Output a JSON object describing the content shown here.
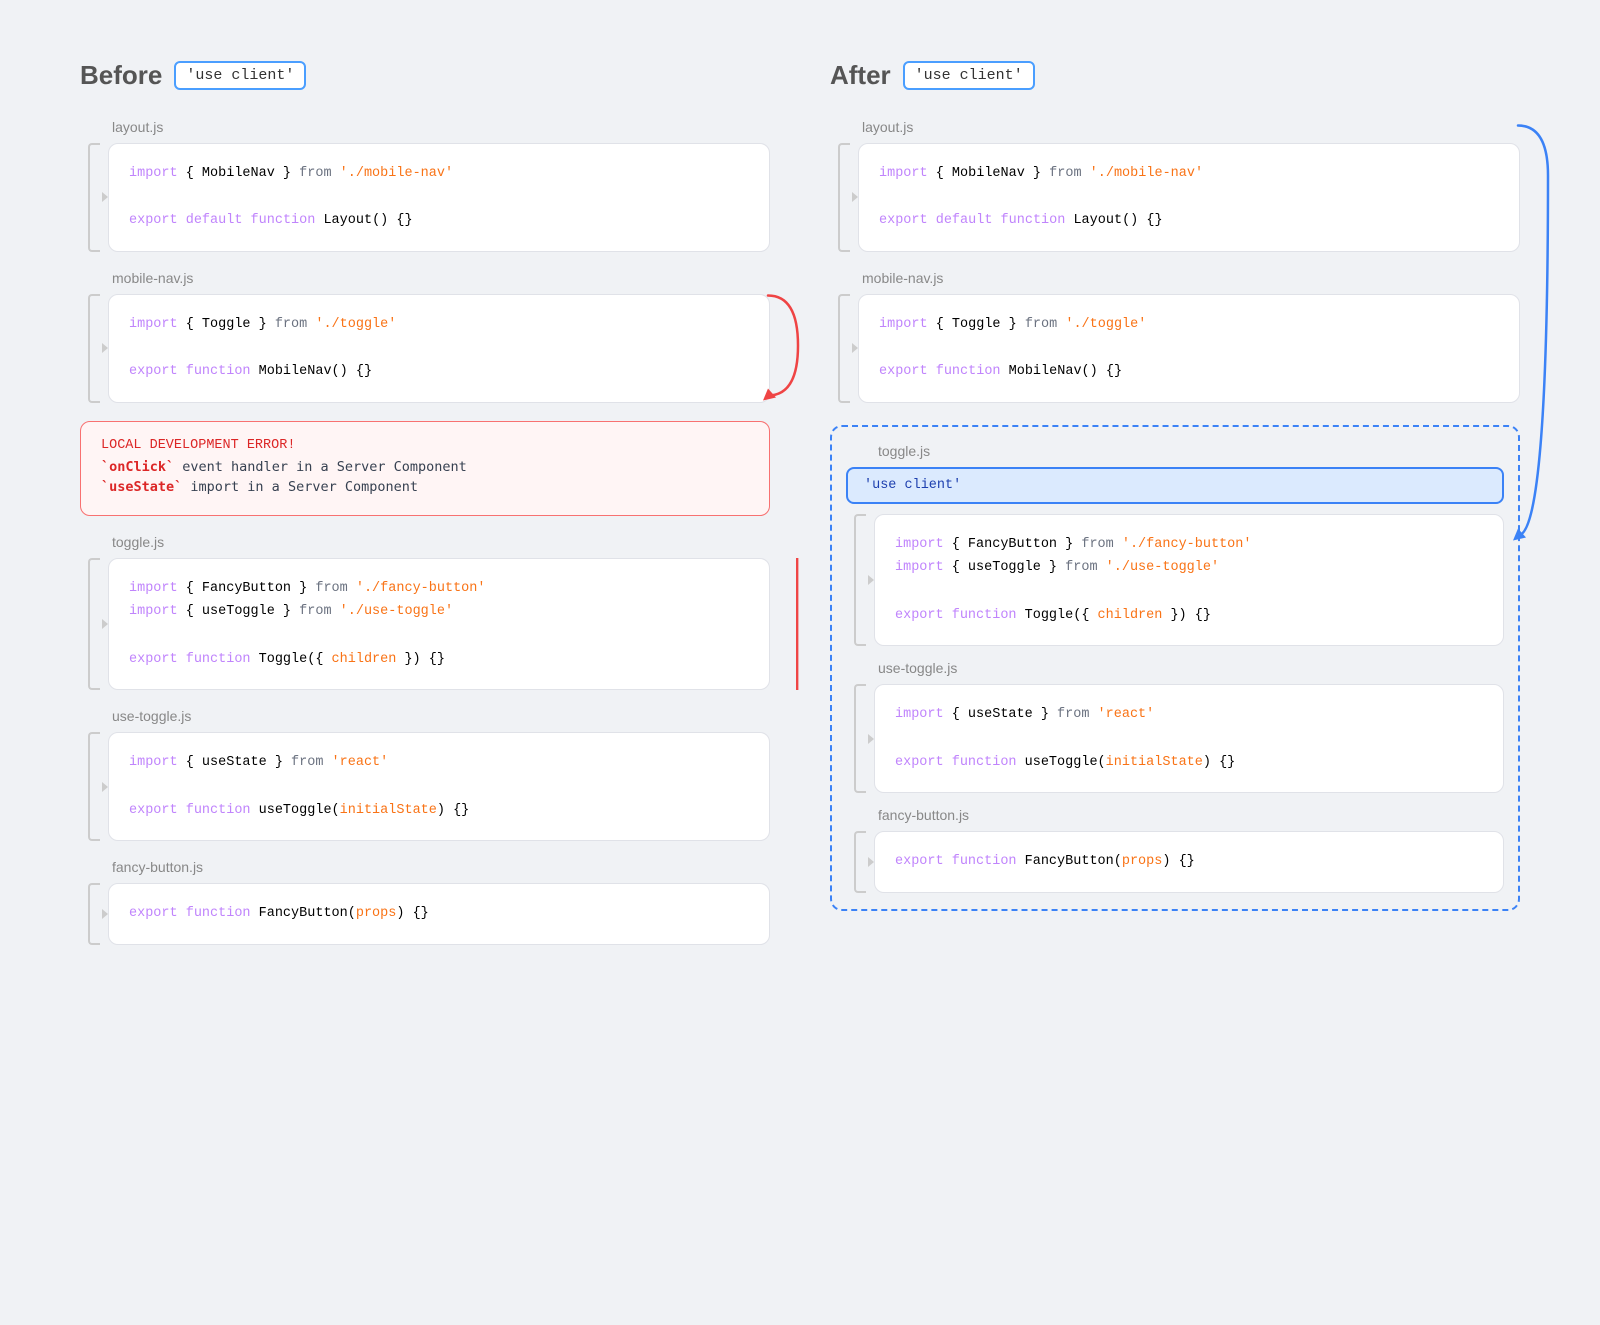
{
  "before": {
    "title": "Before",
    "badge": "'use client'",
    "files": [
      {
        "name": "layout.js",
        "lines": [
          {
            "parts": [
              {
                "text": "import",
                "class": "kw"
              },
              {
                "text": " { MobileNav } ",
                "class": ""
              },
              {
                "text": "from",
                "class": "gray"
              },
              {
                "text": " ",
                "class": ""
              },
              {
                "text": "'./mobile-nav'",
                "class": "str"
              }
            ]
          },
          {
            "parts": []
          },
          {
            "parts": [
              {
                "text": "export",
                "class": "kw"
              },
              {
                "text": " ",
                "class": ""
              },
              {
                "text": "default",
                "class": "kw"
              },
              {
                "text": " ",
                "class": ""
              },
              {
                "text": "function",
                "class": "kw"
              },
              {
                "text": " Layout() {}",
                "class": ""
              }
            ]
          }
        ]
      },
      {
        "name": "mobile-nav.js",
        "lines": [
          {
            "parts": [
              {
                "text": "import",
                "class": "kw"
              },
              {
                "text": " { Toggle } ",
                "class": ""
              },
              {
                "text": "from",
                "class": "gray"
              },
              {
                "text": " ",
                "class": ""
              },
              {
                "text": "'./toggle'",
                "class": "str"
              }
            ]
          },
          {
            "parts": []
          },
          {
            "parts": [
              {
                "text": "export",
                "class": "kw"
              },
              {
                "text": " ",
                "class": ""
              },
              {
                "text": "function",
                "class": "kw"
              },
              {
                "text": " MobileNav() {}",
                "class": ""
              }
            ]
          }
        ]
      }
    ],
    "error": {
      "title": "LOCAL DEVELOPMENT ERROR!",
      "lines": [
        "`onClick` event handler in a Server Component",
        "`useState` import in a Server Component"
      ]
    },
    "toggle": {
      "name": "toggle.js",
      "lines": [
        {
          "parts": [
            {
              "text": "import",
              "class": "kw"
            },
            {
              "text": " { FancyButton } ",
              "class": ""
            },
            {
              "text": "from",
              "class": "gray"
            },
            {
              "text": " ",
              "class": ""
            },
            {
              "text": "'./fancy-button'",
              "class": "str"
            }
          ]
        },
        {
          "parts": [
            {
              "text": "import",
              "class": "kw"
            },
            {
              "text": " { useToggle } ",
              "class": ""
            },
            {
              "text": "from",
              "class": "gray"
            },
            {
              "text": " ",
              "class": ""
            },
            {
              "text": "'./use-toggle'",
              "class": "str"
            }
          ]
        },
        {
          "parts": []
        },
        {
          "parts": [
            {
              "text": "export",
              "class": "kw"
            },
            {
              "text": " ",
              "class": ""
            },
            {
              "text": "function",
              "class": "kw"
            },
            {
              "text": " Toggle({ ",
              "class": ""
            },
            {
              "text": "children",
              "class": "orange"
            },
            {
              "text": " }) {}",
              "class": ""
            }
          ]
        }
      ]
    },
    "useToggle": {
      "name": "use-toggle.js",
      "lines": [
        {
          "parts": [
            {
              "text": "import",
              "class": "kw"
            },
            {
              "text": " { useState } ",
              "class": ""
            },
            {
              "text": "from",
              "class": "gray"
            },
            {
              "text": " ",
              "class": ""
            },
            {
              "text": "'react'",
              "class": "str"
            }
          ]
        },
        {
          "parts": []
        },
        {
          "parts": [
            {
              "text": "export",
              "class": "kw"
            },
            {
              "text": " ",
              "class": ""
            },
            {
              "text": "function",
              "class": "kw"
            },
            {
              "text": " useToggle(",
              "class": ""
            },
            {
              "text": "initialState",
              "class": "orange"
            },
            {
              "text": ") {}",
              "class": ""
            }
          ]
        }
      ]
    },
    "fancyButton": {
      "name": "fancy-button.js",
      "lines": [
        {
          "parts": [
            {
              "text": "export",
              "class": "kw"
            },
            {
              "text": " ",
              "class": ""
            },
            {
              "text": "function",
              "class": "kw"
            },
            {
              "text": " FancyButton(",
              "class": ""
            },
            {
              "text": "props",
              "class": "orange"
            },
            {
              "text": ") {}",
              "class": ""
            }
          ]
        }
      ]
    }
  },
  "after": {
    "title": "After",
    "badge": "'use client'",
    "files": [
      {
        "name": "layout.js",
        "lines": [
          {
            "parts": [
              {
                "text": "import",
                "class": "kw"
              },
              {
                "text": " { MobileNav } ",
                "class": ""
              },
              {
                "text": "from",
                "class": "gray"
              },
              {
                "text": " ",
                "class": ""
              },
              {
                "text": "'./mobile-nav'",
                "class": "str"
              }
            ]
          },
          {
            "parts": []
          },
          {
            "parts": [
              {
                "text": "export",
                "class": "kw"
              },
              {
                "text": " ",
                "class": ""
              },
              {
                "text": "default",
                "class": "kw"
              },
              {
                "text": " ",
                "class": ""
              },
              {
                "text": "function",
                "class": "kw"
              },
              {
                "text": " Layout() {}",
                "class": ""
              }
            ]
          }
        ]
      },
      {
        "name": "mobile-nav.js",
        "lines": [
          {
            "parts": [
              {
                "text": "import",
                "class": "kw"
              },
              {
                "text": " { Toggle } ",
                "class": ""
              },
              {
                "text": "from",
                "class": "gray"
              },
              {
                "text": " ",
                "class": ""
              },
              {
                "text": "'./toggle'",
                "class": "str"
              }
            ]
          },
          {
            "parts": []
          },
          {
            "parts": [
              {
                "text": "export",
                "class": "kw"
              },
              {
                "text": " ",
                "class": ""
              },
              {
                "text": "function",
                "class": "kw"
              },
              {
                "text": " MobileNav() {}",
                "class": ""
              }
            ]
          }
        ]
      }
    ],
    "toggleSection": {
      "name": "toggle.js",
      "useClient": "'use client'",
      "lines": [
        {
          "parts": [
            {
              "text": "import",
              "class": "kw"
            },
            {
              "text": " { FancyButton } ",
              "class": ""
            },
            {
              "text": "from",
              "class": "gray"
            },
            {
              "text": " ",
              "class": ""
            },
            {
              "text": "'./fancy-button'",
              "class": "str"
            }
          ]
        },
        {
          "parts": [
            {
              "text": "import",
              "class": "kw"
            },
            {
              "text": " { useToggle } ",
              "class": ""
            },
            {
              "text": "from",
              "class": "gray"
            },
            {
              "text": " ",
              "class": ""
            },
            {
              "text": "'./use-toggle'",
              "class": "str"
            }
          ]
        },
        {
          "parts": []
        },
        {
          "parts": [
            {
              "text": "export",
              "class": "kw"
            },
            {
              "text": " ",
              "class": ""
            },
            {
              "text": "function",
              "class": "kw"
            },
            {
              "text": " Toggle({ ",
              "class": ""
            },
            {
              "text": "children",
              "class": "orange"
            },
            {
              "text": " }) {}",
              "class": ""
            }
          ]
        }
      ]
    },
    "useToggle": {
      "name": "use-toggle.js",
      "lines": [
        {
          "parts": [
            {
              "text": "import",
              "class": "kw"
            },
            {
              "text": " { useState } ",
              "class": ""
            },
            {
              "text": "from",
              "class": "gray"
            },
            {
              "text": " ",
              "class": ""
            },
            {
              "text": "'react'",
              "class": "str"
            }
          ]
        },
        {
          "parts": []
        },
        {
          "parts": [
            {
              "text": "export",
              "class": "kw"
            },
            {
              "text": " ",
              "class": ""
            },
            {
              "text": "function",
              "class": "kw"
            },
            {
              "text": " useToggle(",
              "class": ""
            },
            {
              "text": "initialState",
              "class": "orange"
            },
            {
              "text": ") {}",
              "class": ""
            }
          ]
        }
      ]
    },
    "fancyButton": {
      "name": "fancy-button.js",
      "lines": [
        {
          "parts": [
            {
              "text": "export",
              "class": "kw"
            },
            {
              "text": " ",
              "class": ""
            },
            {
              "text": "function",
              "class": "kw"
            },
            {
              "text": " FancyButton(",
              "class": ""
            },
            {
              "text": "props",
              "class": "orange"
            },
            {
              "text": ") {}",
              "class": ""
            }
          ]
        }
      ]
    }
  }
}
